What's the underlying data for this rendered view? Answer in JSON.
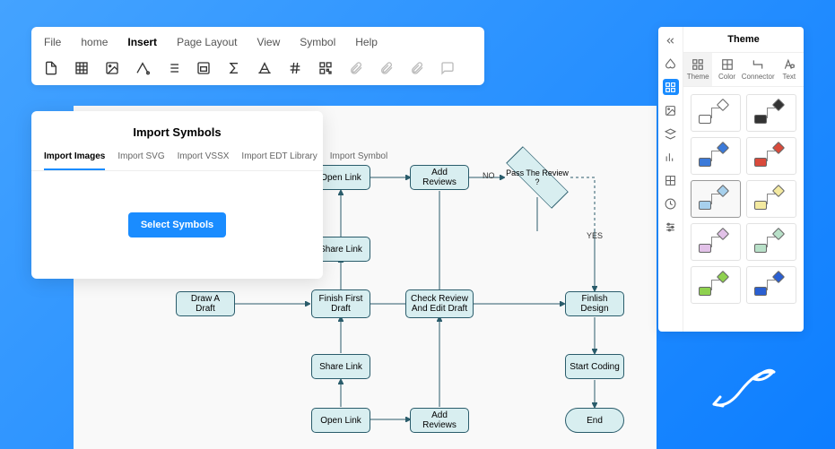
{
  "menu": {
    "items": [
      "File",
      "home",
      "Insert",
      "Page Layout",
      "View",
      "Symbol",
      "Help"
    ],
    "active": 2
  },
  "dialog": {
    "title": "Import Symbols",
    "tabs": [
      "Import Images",
      "Import SVG",
      "Import VSSX",
      "Import EDT Library",
      "Import Symbol"
    ],
    "active": 0,
    "button": "Select Symbols"
  },
  "panel": {
    "title": "Theme",
    "tabs": [
      "Theme",
      "Color",
      "Connector",
      "Text"
    ],
    "active": 0,
    "thumb_colors": [
      [
        "#ffffff",
        "#ffffff"
      ],
      [
        "#333333",
        "#333333"
      ],
      [
        "#3b7ad9",
        "#3b7ad9"
      ],
      [
        "#d94a3b",
        "#d94a3b"
      ],
      [
        "#a7d0ec",
        "#a7d0ec"
      ],
      [
        "#f3e9a0",
        "#f3e9a0"
      ],
      [
        "#e2c1e8",
        "#e2c1e8"
      ],
      [
        "#b8e0c8",
        "#b8e0c8"
      ],
      [
        "#8fd14f",
        "#8fd14f"
      ],
      [
        "#2a5fd1",
        "#2a5fd1"
      ]
    ],
    "selected": 4
  },
  "flow": {
    "n": [
      "Open Link",
      "Add Reviews",
      "Pass\nThe Review ?",
      "Share Link",
      "Draw A Draft",
      "Finish\nFirst Draft",
      "Check Review\nAnd Edit Draft",
      "Finlish Design",
      "Share Link",
      "Open Link",
      "Add Reviews",
      "Start Coding",
      "End"
    ],
    "labels": {
      "no": "NO",
      "yes": "YES"
    }
  }
}
